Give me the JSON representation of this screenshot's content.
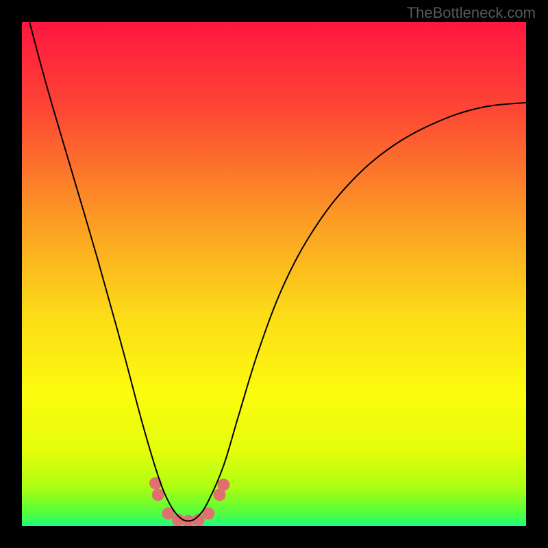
{
  "attribution": "TheBottleneck.com",
  "chart_data": {
    "type": "line",
    "title": "",
    "xlabel": "",
    "ylabel": "",
    "xlim": [
      0,
      1
    ],
    "ylim": [
      0,
      1
    ],
    "curve": {
      "name": "bottleneck-curve",
      "color": "#000000",
      "stroke_width": 2,
      "x": [
        0.015,
        0.05,
        0.1,
        0.15,
        0.2,
        0.24,
        0.27,
        0.29,
        0.31,
        0.33,
        0.35,
        0.37,
        0.4,
        0.43,
        0.47,
        0.52,
        0.58,
        0.65,
        0.73,
        0.82,
        0.91,
        1.0
      ],
      "y": [
        1.0,
        0.87,
        0.7,
        0.53,
        0.35,
        0.2,
        0.1,
        0.05,
        0.02,
        0.01,
        0.02,
        0.05,
        0.12,
        0.22,
        0.35,
        0.48,
        0.59,
        0.68,
        0.75,
        0.8,
        0.83,
        0.84
      ]
    },
    "dots": {
      "color": "#e07070",
      "radius": 9,
      "points": [
        {
          "x": 0.265,
          "y": 0.085
        },
        {
          "x": 0.27,
          "y": 0.062
        },
        {
          "x": 0.29,
          "y": 0.025
        },
        {
          "x": 0.31,
          "y": 0.012
        },
        {
          "x": 0.33,
          "y": 0.01
        },
        {
          "x": 0.35,
          "y": 0.012
        },
        {
          "x": 0.37,
          "y": 0.025
        },
        {
          "x": 0.392,
          "y": 0.062
        },
        {
          "x": 0.4,
          "y": 0.082
        }
      ]
    },
    "gradient_stops": [
      {
        "offset": 0.0,
        "color": "#fe163f"
      },
      {
        "offset": 0.18,
        "color": "#fd4934"
      },
      {
        "offset": 0.4,
        "color": "#fc9e24"
      },
      {
        "offset": 0.58,
        "color": "#fcdb18"
      },
      {
        "offset": 0.74,
        "color": "#fcfc0e"
      },
      {
        "offset": 0.85,
        "color": "#e4fd0b"
      },
      {
        "offset": 0.92,
        "color": "#b0fe13"
      },
      {
        "offset": 0.94,
        "color": "#8efe1f"
      },
      {
        "offset": 0.96,
        "color": "#6cfe30"
      },
      {
        "offset": 0.98,
        "color": "#48fe48"
      },
      {
        "offset": 1.0,
        "color": "#1bfe83"
      }
    ]
  }
}
